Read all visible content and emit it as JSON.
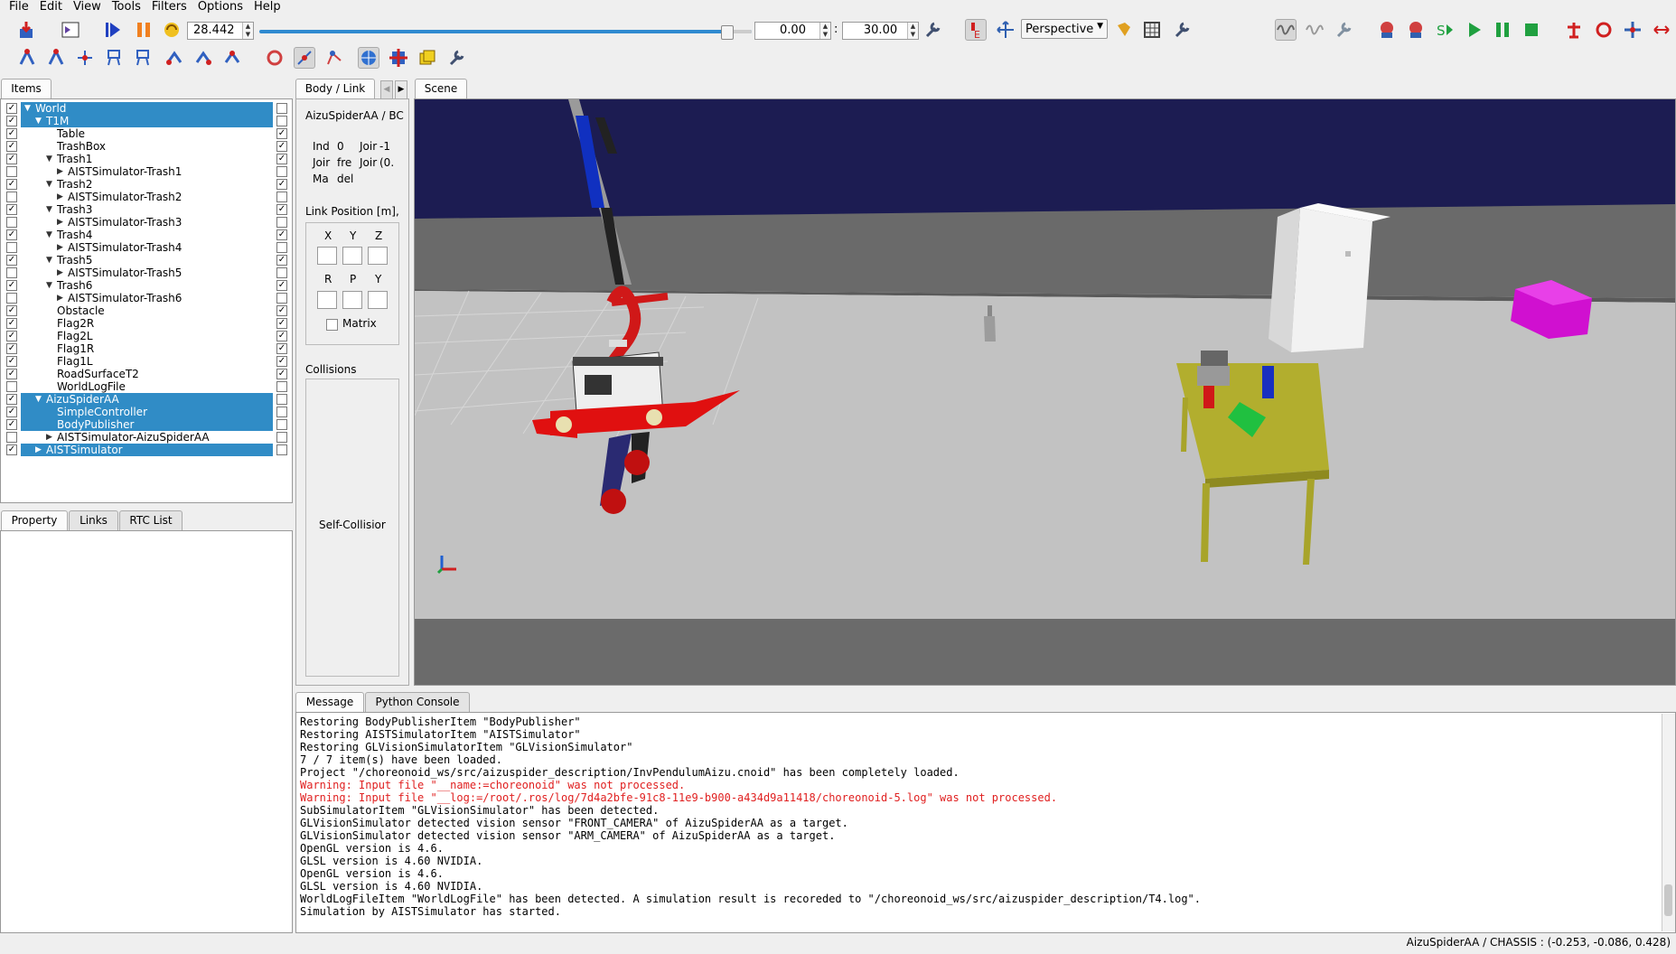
{
  "menu": [
    "File",
    "Edit",
    "View",
    "Tools",
    "Filters",
    "Options",
    "Help"
  ],
  "toolbar": {
    "time_value": "28.442",
    "time_start": "0.00",
    "time_end": "30.00",
    "time_sep": ":",
    "slider_fraction": 0.948,
    "view_mode": "Perspective"
  },
  "items_panel": {
    "tab": "Items",
    "tree": [
      {
        "label": "World",
        "depth": 0,
        "expand": "open",
        "checked": true,
        "right": false,
        "selected": true
      },
      {
        "label": "T1M",
        "depth": 1,
        "expand": "open",
        "checked": true,
        "right": false,
        "selected": true
      },
      {
        "label": "Table",
        "depth": 2,
        "expand": "none",
        "checked": true,
        "right": true,
        "selected": false
      },
      {
        "label": "TrashBox",
        "depth": 2,
        "expand": "none",
        "checked": true,
        "right": true,
        "selected": false
      },
      {
        "label": "Trash1",
        "depth": 2,
        "expand": "open",
        "checked": true,
        "right": true,
        "selected": false
      },
      {
        "label": "AISTSimulator-Trash1",
        "depth": 3,
        "expand": "closed",
        "checked": false,
        "right": false,
        "selected": false
      },
      {
        "label": "Trash2",
        "depth": 2,
        "expand": "open",
        "checked": true,
        "right": true,
        "selected": false
      },
      {
        "label": "AISTSimulator-Trash2",
        "depth": 3,
        "expand": "closed",
        "checked": false,
        "right": false,
        "selected": false
      },
      {
        "label": "Trash3",
        "depth": 2,
        "expand": "open",
        "checked": true,
        "right": true,
        "selected": false
      },
      {
        "label": "AISTSimulator-Trash3",
        "depth": 3,
        "expand": "closed",
        "checked": false,
        "right": false,
        "selected": false
      },
      {
        "label": "Trash4",
        "depth": 2,
        "expand": "open",
        "checked": true,
        "right": true,
        "selected": false
      },
      {
        "label": "AISTSimulator-Trash4",
        "depth": 3,
        "expand": "closed",
        "checked": false,
        "right": false,
        "selected": false
      },
      {
        "label": "Trash5",
        "depth": 2,
        "expand": "open",
        "checked": true,
        "right": true,
        "selected": false
      },
      {
        "label": "AISTSimulator-Trash5",
        "depth": 3,
        "expand": "closed",
        "checked": false,
        "right": false,
        "selected": false
      },
      {
        "label": "Trash6",
        "depth": 2,
        "expand": "open",
        "checked": true,
        "right": true,
        "selected": false
      },
      {
        "label": "AISTSimulator-Trash6",
        "depth": 3,
        "expand": "closed",
        "checked": false,
        "right": false,
        "selected": false
      },
      {
        "label": "Obstacle",
        "depth": 2,
        "expand": "none",
        "checked": true,
        "right": true,
        "selected": false
      },
      {
        "label": "Flag2R",
        "depth": 2,
        "expand": "none",
        "checked": true,
        "right": true,
        "selected": false
      },
      {
        "label": "Flag2L",
        "depth": 2,
        "expand": "none",
        "checked": true,
        "right": true,
        "selected": false
      },
      {
        "label": "Flag1R",
        "depth": 2,
        "expand": "none",
        "checked": true,
        "right": true,
        "selected": false
      },
      {
        "label": "Flag1L",
        "depth": 2,
        "expand": "none",
        "checked": true,
        "right": true,
        "selected": false
      },
      {
        "label": "RoadSurfaceT2",
        "depth": 2,
        "expand": "none",
        "checked": true,
        "right": true,
        "selected": false
      },
      {
        "label": "WorldLogFile",
        "depth": 2,
        "expand": "none",
        "checked": false,
        "right": false,
        "selected": false
      },
      {
        "label": "AizuSpiderAA",
        "depth": 1,
        "expand": "open",
        "checked": true,
        "right": false,
        "selected": true
      },
      {
        "label": "SimpleController",
        "depth": 2,
        "expand": "none",
        "checked": true,
        "right": false,
        "selected": true
      },
      {
        "label": "BodyPublisher",
        "depth": 2,
        "expand": "none",
        "checked": true,
        "right": false,
        "selected": true
      },
      {
        "label": "AISTSimulator-AizuSpiderAA",
        "depth": 2,
        "expand": "closed",
        "checked": false,
        "right": false,
        "selected": false
      },
      {
        "label": "AISTSimulator",
        "depth": 1,
        "expand": "closed",
        "checked": true,
        "right": false,
        "selected": true
      }
    ]
  },
  "lower_tabs": [
    "Property",
    "Links",
    "RTC List"
  ],
  "body_link": {
    "tab": "Body / Link",
    "title": "AizuSpiderAA / BC",
    "info_rows": [
      [
        "Ind",
        "0",
        "Joir",
        "-1"
      ],
      [
        "Joir",
        "fre",
        "Joir",
        "(0."
      ],
      [
        "Ma",
        "del",
        "",
        ""
      ]
    ],
    "link_position_label": "Link Position [m],",
    "xyz": [
      "X",
      "Y",
      "Z"
    ],
    "rpy": [
      "R",
      "P",
      "Y"
    ],
    "matrix_label": "Matrix",
    "collisions_label": "Collisions",
    "self_collision_label": "Self-Collisior"
  },
  "scene_tab": "Scene",
  "message_tabs": [
    "Message",
    "Python Console"
  ],
  "messages": [
    {
      "text": "Restoring BodyPublisherItem \"BodyPublisher\"",
      "warn": false
    },
    {
      "text": "Restoring AISTSimulatorItem \"AISTSimulator\"",
      "warn": false
    },
    {
      "text": "Restoring GLVisionSimulatorItem \"GLVisionSimulator\"",
      "warn": false
    },
    {
      "text": "7 / 7 item(s) have been loaded.",
      "warn": false
    },
    {
      "text": "Project \"/choreonoid_ws/src/aizuspider_description/InvPendulumAizu.cnoid\" has been completely loaded.",
      "warn": false
    },
    {
      "text": "Warning: Input file \"__name:=choreonoid\" was not processed.",
      "warn": true
    },
    {
      "text": "Warning: Input file \"__log:=/root/.ros/log/7d4a2bfe-91c8-11e9-b900-a434d9a11418/choreonoid-5.log\" was not processed.",
      "warn": true
    },
    {
      "text": "SubSimulatorItem \"GLVisionSimulator\" has been detected.",
      "warn": false
    },
    {
      "text": "GLVisionSimulator detected vision sensor \"FRONT_CAMERA\" of AizuSpiderAA as a target.",
      "warn": false
    },
    {
      "text": "GLVisionSimulator detected vision sensor \"ARM_CAMERA\" of AizuSpiderAA as a target.",
      "warn": false
    },
    {
      "text": "OpenGL version is 4.6.",
      "warn": false
    },
    {
      "text": "GLSL version is 4.60 NVIDIA.",
      "warn": false
    },
    {
      "text": "OpenGL version is 4.6.",
      "warn": false
    },
    {
      "text": "GLSL version is 4.60 NVIDIA.",
      "warn": false
    },
    {
      "text": "WorldLogFileItem \"WorldLogFile\" has been detected. A simulation result is recoreded to \"/choreonoid_ws/src/aizuspider_description/T4.log\".",
      "warn": false
    },
    {
      "text": "Simulation by AISTSimulator has started.",
      "warn": false
    }
  ],
  "status": "AizuSpiderAA / CHASSIS : (-0.253, -0.086, 0.428)"
}
